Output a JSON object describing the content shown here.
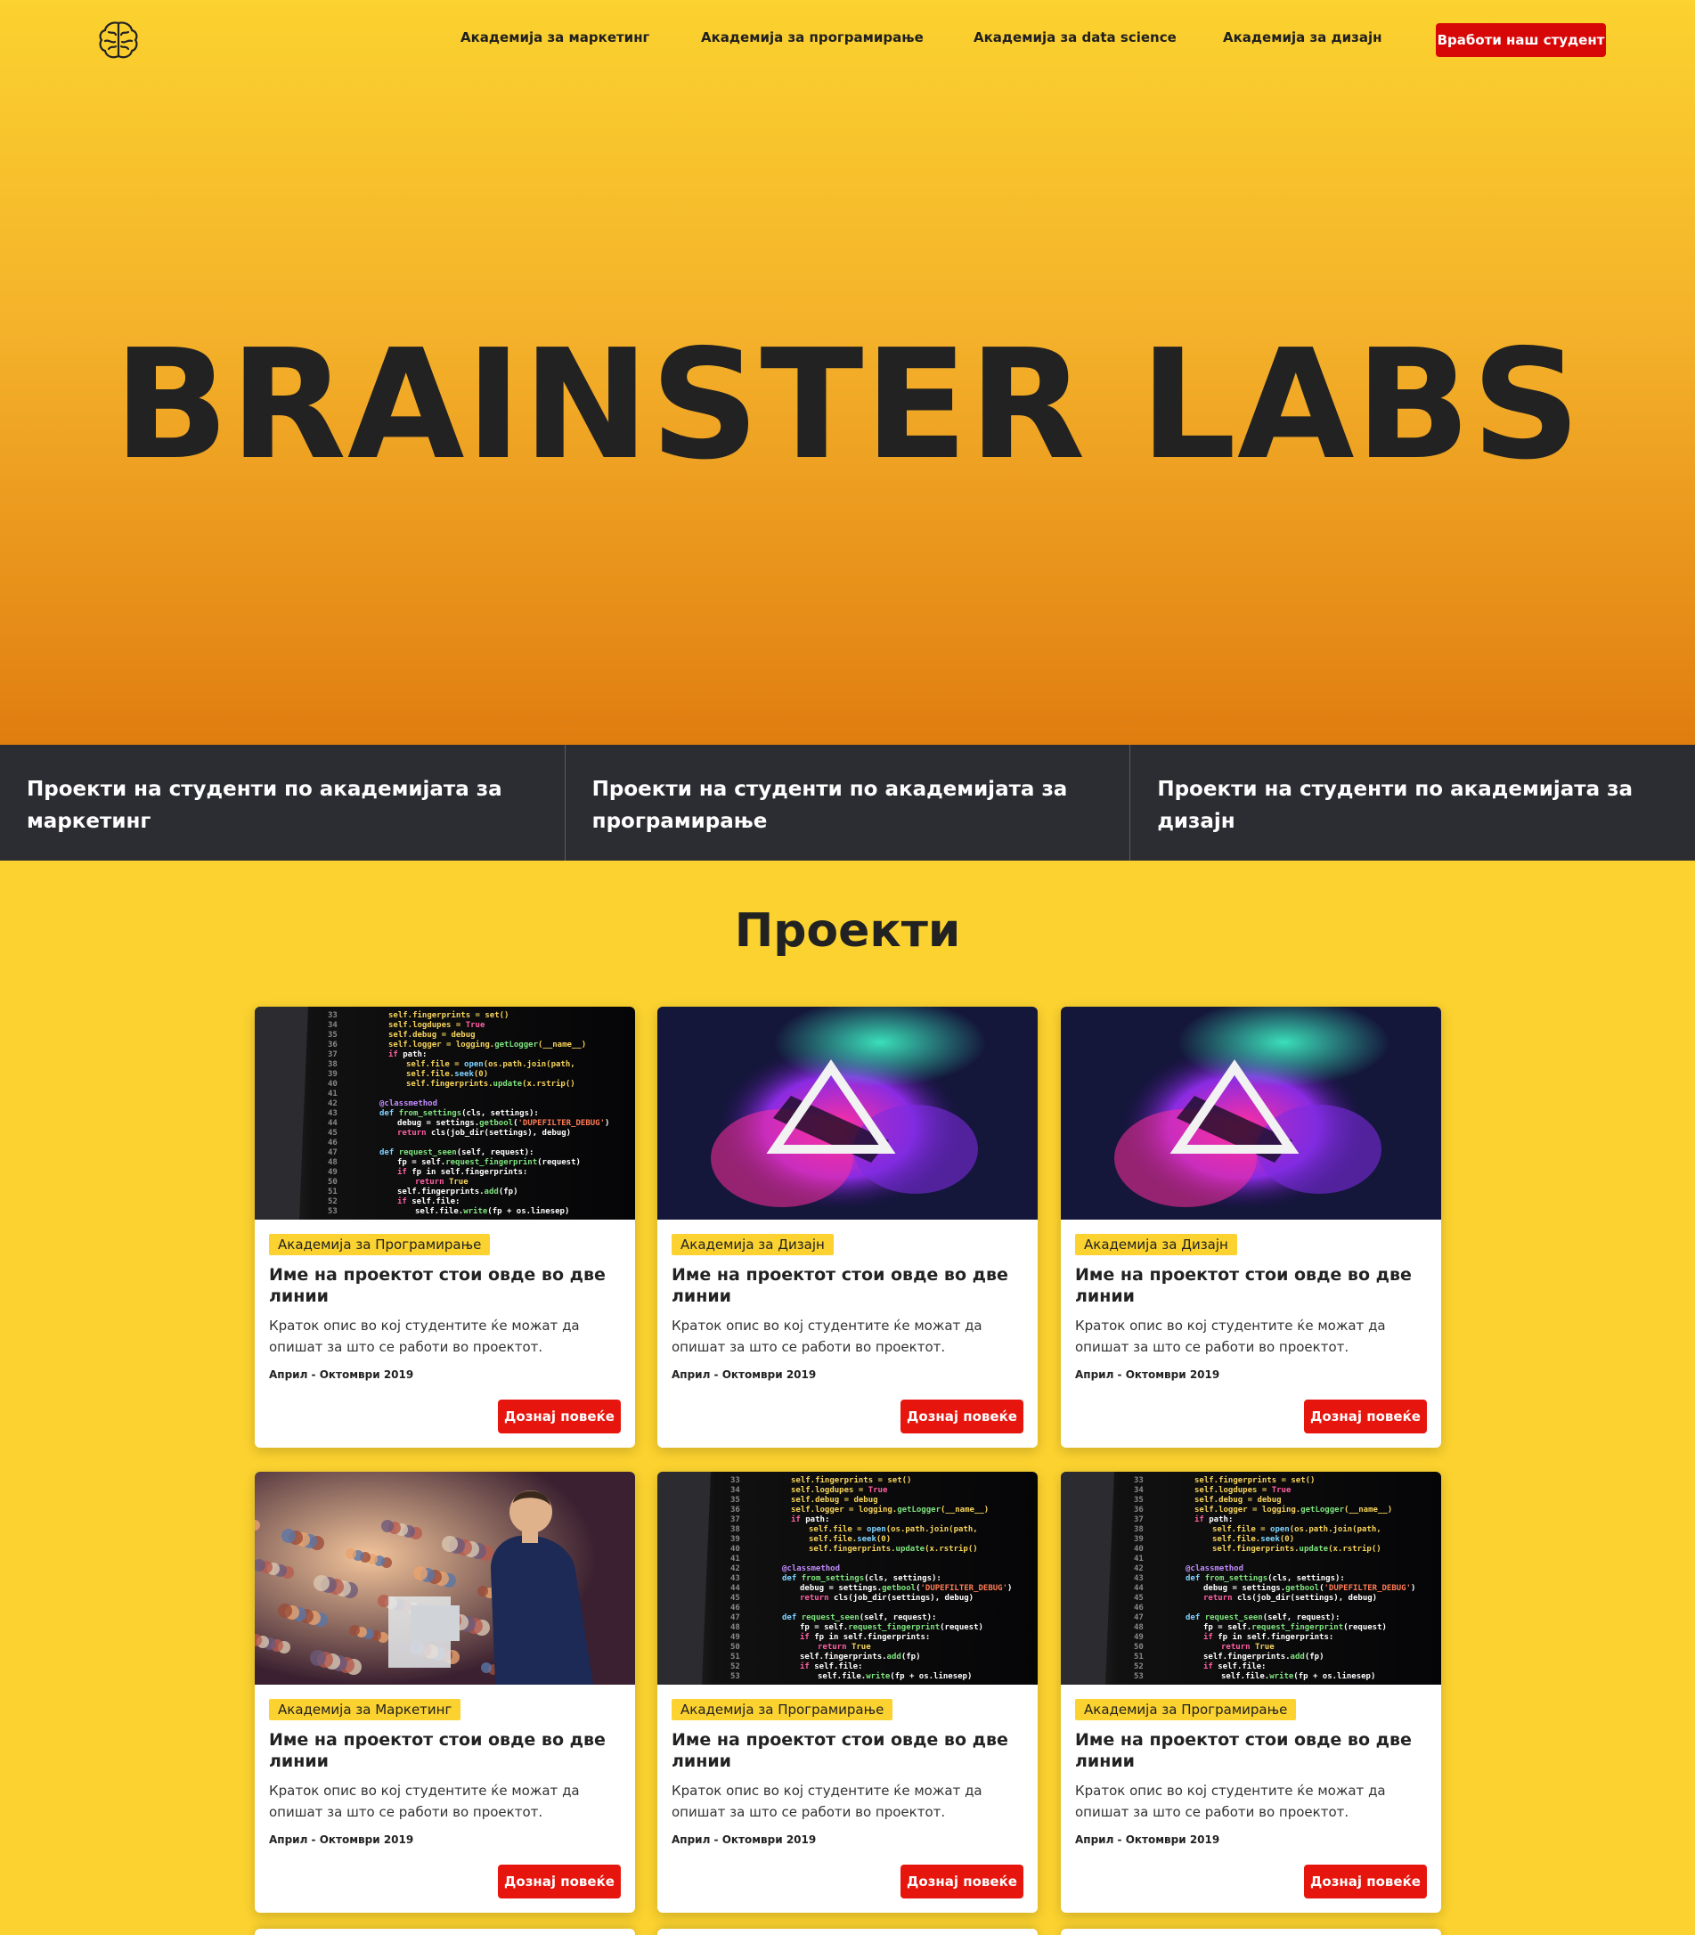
{
  "nav": {
    "logo_icon": "brain-icon",
    "links": [
      "Академија за маркетинг",
      "Академија за програмирање",
      "Академија за data science",
      "Академија за дизајн"
    ],
    "cta_label": "Вработи наш студент",
    "cta_color": "#d80707"
  },
  "hero": {
    "title": "BRAINSTER LABS"
  },
  "categories": [
    "Проекти на студенти по академијата за маркетинг",
    "Проекти на студенти по академијата за програмирање",
    "Проекти на студенти по академијата за дизајн"
  ],
  "projects": {
    "title": "Проекти",
    "cards": [
      {
        "image": "code-screen-image",
        "tag": "Академија за Програмирање",
        "title": "Име на проектот стои овде во две линии",
        "desc": "Краток опис во кој студентите ќе можат да опишат за што се работи во проектот.",
        "date": "Април - Октомври 2019",
        "button": "Дознај повеќе"
      },
      {
        "image": "triangle-art-image",
        "tag": "Академија за Дизајн",
        "title": "Име на проектот стои овде во две линии",
        "desc": "Краток опис во кој студентите ќе можат да опишат за што се работи во проектот.",
        "date": "Април - Октомври 2019",
        "button": "Дознај повеќе"
      },
      {
        "image": "triangle-art-image",
        "tag": "Академија за Дизајн",
        "title": "Име на проектот стои овде во две линии",
        "desc": "Краток опис во кој студентите ќе можат да опишат за што се работи во проектот.",
        "date": "Април - Октомври 2019",
        "button": "Дознај повеќе"
      },
      {
        "image": "conference-speaker-image",
        "tag": "Академија за Маркетинг",
        "title": "Име на проектот стои овде во две линии",
        "desc": "Краток опис во кој студентите ќе можат да опишат за што се работи во проектот.",
        "date": "Април - Октомври 2019",
        "button": "Дознај повеќе"
      },
      {
        "image": "code-screen-image",
        "tag": "Академија за Програмирање",
        "title": "Име на проектот стои овде во две линии",
        "desc": "Краток опис во кој студентите ќе можат да опишат за што се работи во проектот.",
        "date": "Април - Октомври 2019",
        "button": "Дознај повеќе"
      },
      {
        "image": "code-screen-image",
        "tag": "Академија за Програмирање",
        "title": "Име на проектот стои овде во две линии",
        "desc": "Краток опис во кој студентите ќе можат да опишат за што се работи во проектот.",
        "date": "Април - Октомври 2019",
        "button": "Дознај повеќе"
      }
    ]
  },
  "colors": {
    "page_bg": "#fbd22f",
    "category_bar": "#2c2c33",
    "button_red": "#e6160e",
    "tag_yellow": "#fbd22f"
  }
}
